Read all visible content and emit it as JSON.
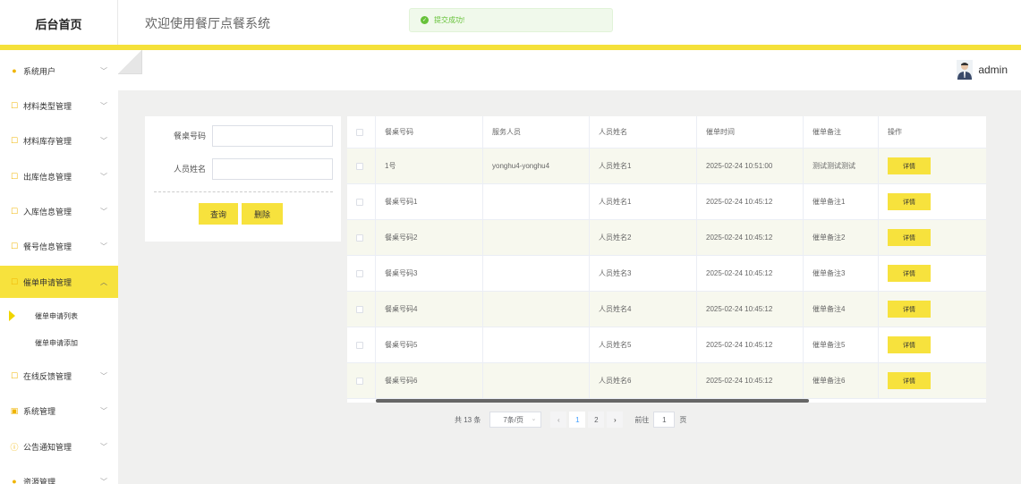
{
  "header": {
    "brand": "后台首页",
    "welcome": "欢迎使用餐厅点餐系统",
    "toast": "提交成功!",
    "user_name": "admin"
  },
  "colors": {
    "accent": "#f7e23d",
    "success": "#67c23a",
    "link": "#409eff"
  },
  "sidebar": {
    "items": [
      {
        "label": "系统用户",
        "icon": "user-icon"
      },
      {
        "label": "材料类型管理",
        "icon": "edit-icon"
      },
      {
        "label": "材料库存管理",
        "icon": "edit-icon"
      },
      {
        "label": "出库信息管理",
        "icon": "edit-icon"
      },
      {
        "label": "入库信息管理",
        "icon": "edit-icon"
      },
      {
        "label": "餐号信息管理",
        "icon": "edit-icon"
      },
      {
        "label": "催单申请管理",
        "icon": "edit-icon",
        "active": true
      },
      {
        "label": "在线反馈管理",
        "icon": "edit-icon"
      },
      {
        "label": "系统管理",
        "icon": "picture-icon"
      },
      {
        "label": "公告通知管理",
        "icon": "info-icon"
      },
      {
        "label": "资源管理",
        "icon": "user-icon"
      }
    ],
    "sub_items": [
      {
        "label": "催单申请列表",
        "current": true
      },
      {
        "label": "催单申请添加"
      }
    ]
  },
  "filter": {
    "table_no_label": "餐桌号码",
    "table_no_value": "",
    "person_label": "人员姓名",
    "person_value": "",
    "query_button": "查询",
    "delete_button": "删除"
  },
  "table": {
    "columns": [
      "餐桌号码",
      "服务人员",
      "人员姓名",
      "催单时间",
      "催单备注",
      "操作"
    ],
    "detail_label": "详情",
    "rows": [
      [
        "1号",
        "yonghu4-yonghu4",
        "人员姓名1",
        "2025-02-24 10:51:00",
        "测试测试测试"
      ],
      [
        "餐桌号码1",
        "",
        "人员姓名1",
        "2025-02-24 10:45:12",
        "催单备注1"
      ],
      [
        "餐桌号码2",
        "",
        "人员姓名2",
        "2025-02-24 10:45:12",
        "催单备注2"
      ],
      [
        "餐桌号码3",
        "",
        "人员姓名3",
        "2025-02-24 10:45:12",
        "催单备注3"
      ],
      [
        "餐桌号码4",
        "",
        "人员姓名4",
        "2025-02-24 10:45:12",
        "催单备注4"
      ],
      [
        "餐桌号码5",
        "",
        "人员姓名5",
        "2025-02-24 10:45:12",
        "催单备注5"
      ],
      [
        "餐桌号码6",
        "",
        "人员姓名6",
        "2025-02-24 10:45:12",
        "催单备注6"
      ]
    ]
  },
  "pagination": {
    "total": "共 13 条",
    "page_size": "7条/页",
    "pages": [
      "1",
      "2"
    ],
    "current_page": "1",
    "goto_label": "前往",
    "goto_value": "1",
    "page_suffix": "页"
  }
}
